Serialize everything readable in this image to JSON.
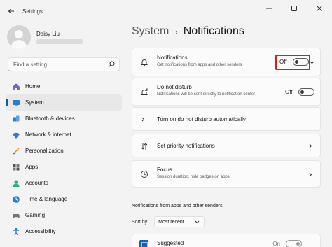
{
  "window": {
    "title": "Settings"
  },
  "profile": {
    "name": "Daisy Liu"
  },
  "search": {
    "placeholder": "Find a setting"
  },
  "nav": [
    {
      "label": "Home",
      "icon": "home-icon"
    },
    {
      "label": "System",
      "icon": "system-icon",
      "selected": true
    },
    {
      "label": "Bluetooth & devices",
      "icon": "bluetooth-icon"
    },
    {
      "label": "Network & internet",
      "icon": "network-icon"
    },
    {
      "label": "Personalization",
      "icon": "personalization-icon"
    },
    {
      "label": "Apps",
      "icon": "apps-icon"
    },
    {
      "label": "Accounts",
      "icon": "accounts-icon"
    },
    {
      "label": "Time & language",
      "icon": "time-language-icon"
    },
    {
      "label": "Gaming",
      "icon": "gaming-icon"
    },
    {
      "label": "Accessibility",
      "icon": "accessibility-icon"
    }
  ],
  "breadcrumb": {
    "parent": "System",
    "separator": "›",
    "current": "Notifications"
  },
  "settings": {
    "notifications": {
      "title": "Notifications",
      "description": "Get notifications from apps and other senders",
      "state": "Off"
    },
    "dnd": {
      "title": "Do not disturb",
      "description": "Notifications will be sent directly to notification center",
      "state": "Off"
    },
    "auto_dnd": {
      "title": "Turn on do not disturb automatically"
    },
    "priority": {
      "title": "Set priority notifications"
    },
    "focus": {
      "title": "Focus",
      "description": "Session duration, hide badges on apps"
    }
  },
  "senders": {
    "section_title": "Notifications from apps and other senders",
    "sort_label": "Sort by:",
    "sort_value": "Most recent",
    "apps": [
      {
        "name": "Suggested",
        "state": "On"
      }
    ]
  },
  "colors": {
    "accent": "#005fb8",
    "highlight": "#e0191f",
    "background": "#f3f3f3",
    "card": "#fbfbfb"
  }
}
